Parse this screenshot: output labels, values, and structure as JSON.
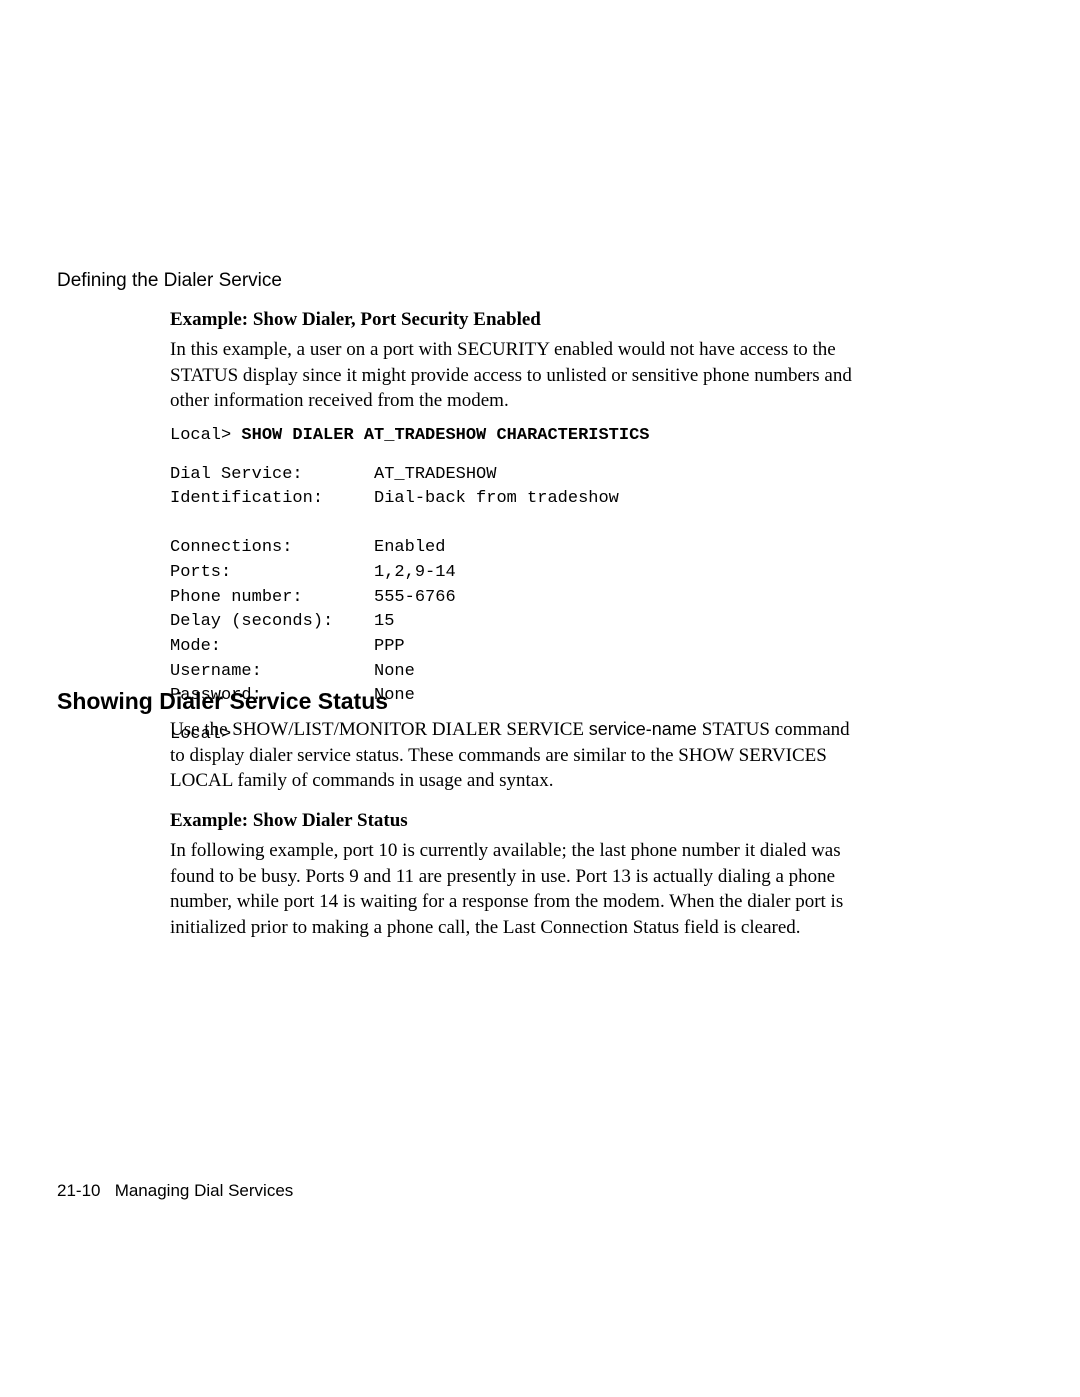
{
  "header": {
    "title": "Defining the Dialer Service"
  },
  "section1": {
    "example_heading": "Example: Show Dialer, Port Security Enabled",
    "intro": "In this example, a user on a port with SECURITY enabled would not have access to the STATUS display since it might provide access to unlisted or sensitive phone numbers and other information received from the modem.",
    "prompt": "Local> ",
    "command": "SHOW DIALER AT_TRADESHOW CHARACTERISTICS",
    "output_rows": [
      {
        "label": "Dial Service:",
        "value": "AT_TRADESHOW"
      },
      {
        "label": "Identification:",
        "value": "Dial-back from tradeshow"
      },
      {
        "label": "",
        "value": ""
      },
      {
        "label": "Connections:",
        "value": "Enabled"
      },
      {
        "label": "Ports:",
        "value": "1,2,9-14"
      },
      {
        "label": "Phone number:",
        "value": "555-6766"
      },
      {
        "label": "Delay (seconds):",
        "value": "15"
      },
      {
        "label": "Mode:",
        "value": "PPP"
      },
      {
        "label": "Username:",
        "value": "None"
      },
      {
        "label": "Password:",
        "value": "None"
      }
    ],
    "trailing_prompt": "Local>"
  },
  "section2": {
    "heading": "Showing Dialer Service Status",
    "body_part1": "Use the SHOW/LIST/MONITOR DIALER SERVICE ",
    "service_name_text": "service-name ",
    "body_part2": "STATUS command to display dialer service status. These commands are similar to the SHOW SERVICES LOCAL family of commands in usage and syntax.",
    "example_heading": "Example: Show Dialer Status",
    "example_body": "In following example, port 10 is currently available; the last phone number it dialed was found to be busy. Ports 9 and 11 are presently in use. Port 13 is actually dialing a phone number, while port 14 is waiting for a response from the modem. When the dialer port is initialized prior to making a phone call, the Last Connection Status field is cleared."
  },
  "footer": {
    "page_number": "21-10",
    "section_title": "Managing Dial Services"
  }
}
